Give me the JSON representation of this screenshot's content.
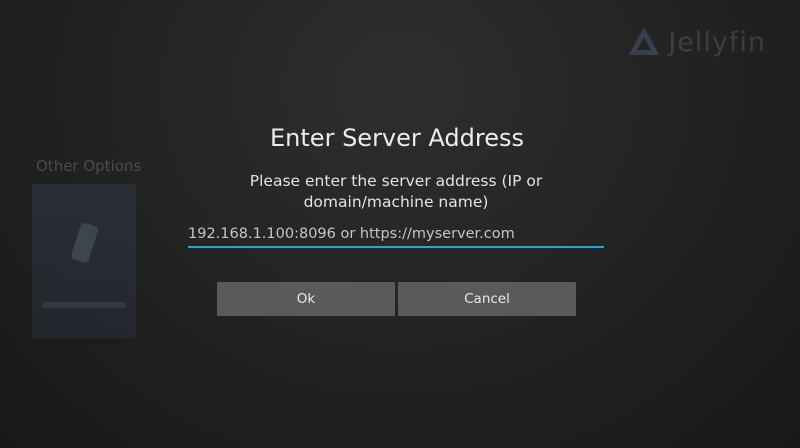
{
  "background": {
    "brand_name": "Jellyfin",
    "section_title": "Other Options",
    "logo_icon": "jellyfin-logo-icon",
    "tile_icon": "phone-icon"
  },
  "dialog": {
    "title": "Enter Server Address",
    "message": "Please enter the server address (IP or domain/machine name)",
    "input": {
      "value": "",
      "placeholder": "192.168.1.100:8096 or https://myserver.com"
    },
    "ok_label": "Ok",
    "cancel_label": "Cancel"
  },
  "colors": {
    "accent": "#1eaad8",
    "button_bg": "#5a5a5a",
    "background": "#242424"
  }
}
